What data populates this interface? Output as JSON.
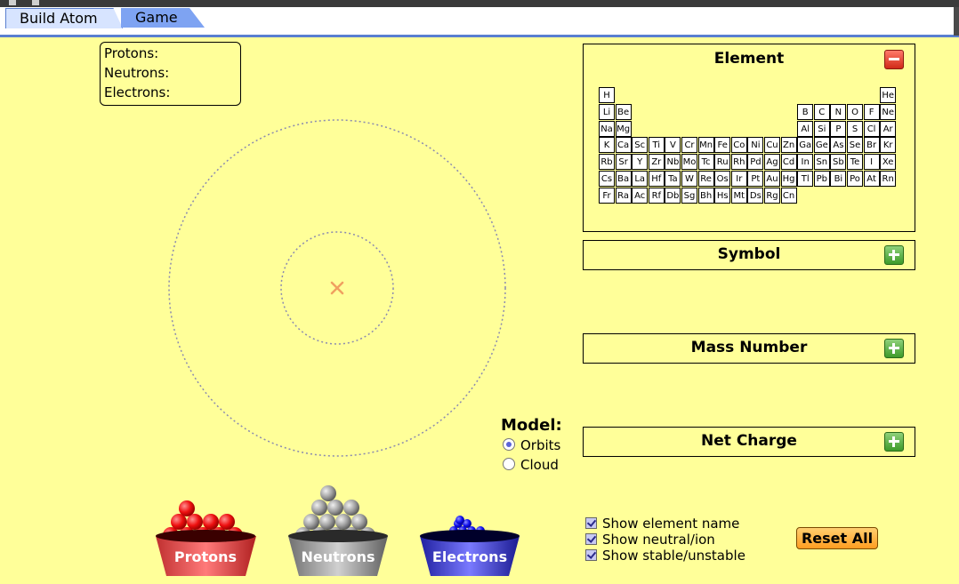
{
  "tabs": [
    {
      "label": "Build Atom",
      "active": true
    },
    {
      "label": "Game",
      "active": false
    }
  ],
  "counts": {
    "protons_label": "Protons:",
    "neutrons_label": "Neutrons:",
    "electrons_label": "Electrons:"
  },
  "panels": {
    "element": {
      "title": "Element",
      "expanded": true,
      "button": "minus"
    },
    "symbol": {
      "title": "Symbol",
      "expanded": false,
      "button": "plus"
    },
    "mass_number": {
      "title": "Mass Number",
      "expanded": false,
      "button": "plus"
    },
    "net_charge": {
      "title": "Net Charge",
      "expanded": false,
      "button": "plus"
    }
  },
  "periodic_table": [
    {
      "sym": "H",
      "row": 1,
      "col": 1
    },
    {
      "sym": "He",
      "row": 1,
      "col": 18
    },
    {
      "sym": "Li",
      "row": 2,
      "col": 1
    },
    {
      "sym": "Be",
      "row": 2,
      "col": 2
    },
    {
      "sym": "B",
      "row": 2,
      "col": 13
    },
    {
      "sym": "C",
      "row": 2,
      "col": 14
    },
    {
      "sym": "N",
      "row": 2,
      "col": 15
    },
    {
      "sym": "O",
      "row": 2,
      "col": 16
    },
    {
      "sym": "F",
      "row": 2,
      "col": 17
    },
    {
      "sym": "Ne",
      "row": 2,
      "col": 18
    },
    {
      "sym": "Na",
      "row": 3,
      "col": 1
    },
    {
      "sym": "Mg",
      "row": 3,
      "col": 2
    },
    {
      "sym": "Al",
      "row": 3,
      "col": 13
    },
    {
      "sym": "Si",
      "row": 3,
      "col": 14
    },
    {
      "sym": "P",
      "row": 3,
      "col": 15
    },
    {
      "sym": "S",
      "row": 3,
      "col": 16
    },
    {
      "sym": "Cl",
      "row": 3,
      "col": 17
    },
    {
      "sym": "Ar",
      "row": 3,
      "col": 18
    },
    {
      "sym": "K",
      "row": 4,
      "col": 1
    },
    {
      "sym": "Ca",
      "row": 4,
      "col": 2
    },
    {
      "sym": "Sc",
      "row": 4,
      "col": 3
    },
    {
      "sym": "Ti",
      "row": 4,
      "col": 4
    },
    {
      "sym": "V",
      "row": 4,
      "col": 5
    },
    {
      "sym": "Cr",
      "row": 4,
      "col": 6
    },
    {
      "sym": "Mn",
      "row": 4,
      "col": 7
    },
    {
      "sym": "Fe",
      "row": 4,
      "col": 8
    },
    {
      "sym": "Co",
      "row": 4,
      "col": 9
    },
    {
      "sym": "Ni",
      "row": 4,
      "col": 10
    },
    {
      "sym": "Cu",
      "row": 4,
      "col": 11
    },
    {
      "sym": "Zn",
      "row": 4,
      "col": 12
    },
    {
      "sym": "Ga",
      "row": 4,
      "col": 13
    },
    {
      "sym": "Ge",
      "row": 4,
      "col": 14
    },
    {
      "sym": "As",
      "row": 4,
      "col": 15
    },
    {
      "sym": "Se",
      "row": 4,
      "col": 16
    },
    {
      "sym": "Br",
      "row": 4,
      "col": 17
    },
    {
      "sym": "Kr",
      "row": 4,
      "col": 18
    },
    {
      "sym": "Rb",
      "row": 5,
      "col": 1
    },
    {
      "sym": "Sr",
      "row": 5,
      "col": 2
    },
    {
      "sym": "Y",
      "row": 5,
      "col": 3
    },
    {
      "sym": "Zr",
      "row": 5,
      "col": 4
    },
    {
      "sym": "Nb",
      "row": 5,
      "col": 5
    },
    {
      "sym": "Mo",
      "row": 5,
      "col": 6
    },
    {
      "sym": "Tc",
      "row": 5,
      "col": 7
    },
    {
      "sym": "Ru",
      "row": 5,
      "col": 8
    },
    {
      "sym": "Rh",
      "row": 5,
      "col": 9
    },
    {
      "sym": "Pd",
      "row": 5,
      "col": 10
    },
    {
      "sym": "Ag",
      "row": 5,
      "col": 11
    },
    {
      "sym": "Cd",
      "row": 5,
      "col": 12
    },
    {
      "sym": "In",
      "row": 5,
      "col": 13
    },
    {
      "sym": "Sn",
      "row": 5,
      "col": 14
    },
    {
      "sym": "Sb",
      "row": 5,
      "col": 15
    },
    {
      "sym": "Te",
      "row": 5,
      "col": 16
    },
    {
      "sym": "I",
      "row": 5,
      "col": 17
    },
    {
      "sym": "Xe",
      "row": 5,
      "col": 18
    },
    {
      "sym": "Cs",
      "row": 6,
      "col": 1
    },
    {
      "sym": "Ba",
      "row": 6,
      "col": 2
    },
    {
      "sym": "La",
      "row": 6,
      "col": 3
    },
    {
      "sym": "Hf",
      "row": 6,
      "col": 4
    },
    {
      "sym": "Ta",
      "row": 6,
      "col": 5
    },
    {
      "sym": "W",
      "row": 6,
      "col": 6
    },
    {
      "sym": "Re",
      "row": 6,
      "col": 7
    },
    {
      "sym": "Os",
      "row": 6,
      "col": 8
    },
    {
      "sym": "Ir",
      "row": 6,
      "col": 9
    },
    {
      "sym": "Pt",
      "row": 6,
      "col": 10
    },
    {
      "sym": "Au",
      "row": 6,
      "col": 11
    },
    {
      "sym": "Hg",
      "row": 6,
      "col": 12
    },
    {
      "sym": "Tl",
      "row": 6,
      "col": 13
    },
    {
      "sym": "Pb",
      "row": 6,
      "col": 14
    },
    {
      "sym": "Bi",
      "row": 6,
      "col": 15
    },
    {
      "sym": "Po",
      "row": 6,
      "col": 16
    },
    {
      "sym": "At",
      "row": 6,
      "col": 17
    },
    {
      "sym": "Rn",
      "row": 6,
      "col": 18
    },
    {
      "sym": "Fr",
      "row": 7,
      "col": 1
    },
    {
      "sym": "Ra",
      "row": 7,
      "col": 2
    },
    {
      "sym": "Ac",
      "row": 7,
      "col": 3
    },
    {
      "sym": "Rf",
      "row": 7,
      "col": 4
    },
    {
      "sym": "Db",
      "row": 7,
      "col": 5
    },
    {
      "sym": "Sg",
      "row": 7,
      "col": 6
    },
    {
      "sym": "Bh",
      "row": 7,
      "col": 7
    },
    {
      "sym": "Hs",
      "row": 7,
      "col": 8
    },
    {
      "sym": "Mt",
      "row": 7,
      "col": 9
    },
    {
      "sym": "Ds",
      "row": 7,
      "col": 10
    },
    {
      "sym": "Rg",
      "row": 7,
      "col": 11
    },
    {
      "sym": "Cn",
      "row": 7,
      "col": 12
    }
  ],
  "model": {
    "title": "Model:",
    "options": [
      {
        "label": "Orbits",
        "selected": true
      },
      {
        "label": "Cloud",
        "selected": false
      }
    ]
  },
  "options": [
    {
      "label": "Show element name",
      "checked": true
    },
    {
      "label": "Show neutral/ion",
      "checked": true
    },
    {
      "label": "Show stable/unstable",
      "checked": true
    }
  ],
  "reset_label": "Reset All",
  "buckets": [
    {
      "label": "Protons",
      "color": "#e01010"
    },
    {
      "label": "Neutrons",
      "color": "#9a9a9a"
    },
    {
      "label": "Electrons",
      "color": "#2a2ad0"
    }
  ],
  "colors": {
    "background": "#ffff99",
    "tab_active": "#d7e4ff",
    "tab_inactive": "#7ea3f2",
    "nucleus_marker": "#f0a060",
    "orbit": "#8a8ab0"
  }
}
